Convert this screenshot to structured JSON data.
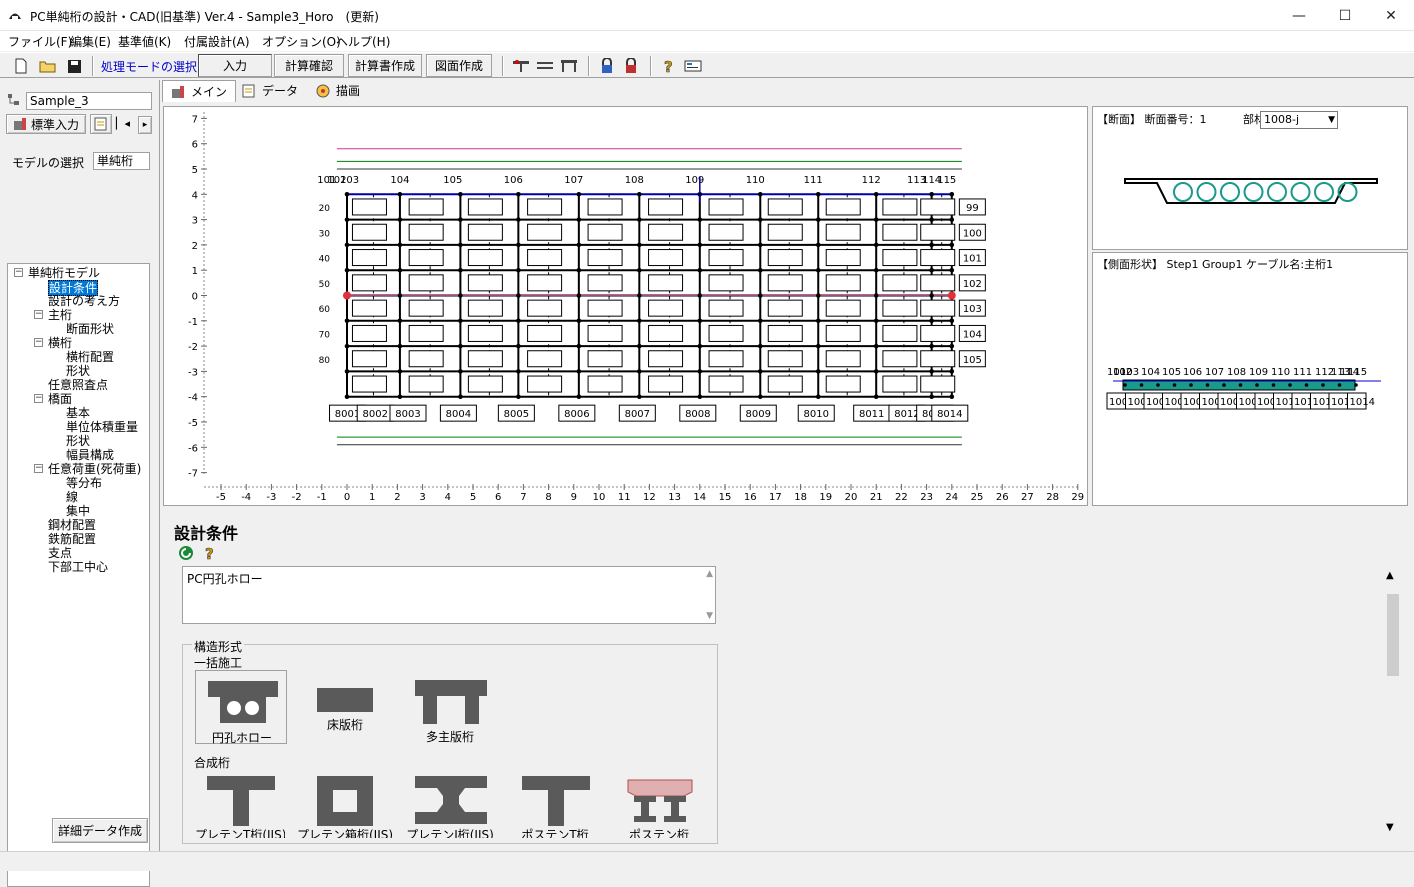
{
  "window": {
    "title": "PC単純桁の設計・CAD(旧基準) Ver.4 - Sample3_Horo　(更新)"
  },
  "menu": [
    "ファイル(F)",
    "編集(E)",
    "基準値(K)",
    "付属設計(A)",
    "オプション(O)",
    "ヘルプ(H)"
  ],
  "toolbar": {
    "mode_label": "処理モードの選択",
    "mode_value": "入力",
    "btn_check": "計算確認",
    "btn_report": "計算書作成",
    "btn_drawing": "図面作成"
  },
  "left": {
    "file_name": "Sample_3",
    "input_tab": "標準入力",
    "model_label": "モデルの選択",
    "model_value": "単純桁",
    "detail_button": "詳細データ作成",
    "tree": [
      {
        "label": "単純桁モデル",
        "level": 0,
        "toggle": "−"
      },
      {
        "label": "設計条件",
        "level": 1,
        "selected": true
      },
      {
        "label": "設計の考え方",
        "level": 1
      },
      {
        "label": "主桁",
        "level": 1,
        "toggle": "−"
      },
      {
        "label": "断面形状",
        "level": 2
      },
      {
        "label": "横桁",
        "level": 1,
        "toggle": "−"
      },
      {
        "label": "横桁配置",
        "level": 2
      },
      {
        "label": "形状",
        "level": 2
      },
      {
        "label": "任意照査点",
        "level": 1
      },
      {
        "label": "橋面",
        "level": 1,
        "toggle": "−"
      },
      {
        "label": "基本",
        "level": 2
      },
      {
        "label": "単位体積重量",
        "level": 2
      },
      {
        "label": "形状",
        "level": 2
      },
      {
        "label": "幅員構成",
        "level": 2
      },
      {
        "label": "任意荷重(死荷重)",
        "level": 1,
        "toggle": "−"
      },
      {
        "label": "等分布",
        "level": 2
      },
      {
        "label": "線",
        "level": 2
      },
      {
        "label": "集中",
        "level": 2
      },
      {
        "label": "鋼材配置",
        "level": 1
      },
      {
        "label": "鉄筋配置",
        "level": 1
      },
      {
        "label": "支点",
        "level": 1
      },
      {
        "label": "下部工中心",
        "level": 1
      }
    ]
  },
  "tabs": [
    "メイン",
    "データ",
    "描画"
  ],
  "plan": {
    "x_ticks": [
      "-5",
      "-4",
      "-3",
      "-2",
      "-1",
      "0",
      "1",
      "2",
      "3",
      "4",
      "5",
      "6",
      "7",
      "8",
      "9",
      "10",
      "11",
      "12",
      "13",
      "14",
      "15",
      "16",
      "17",
      "18",
      "19",
      "20",
      "21",
      "22",
      "23",
      "24",
      "25",
      "26",
      "27",
      "28",
      "29"
    ],
    "y_ticks": [
      "7",
      "6",
      "5",
      "4",
      "3",
      "2",
      "1",
      "0",
      "-1",
      "-2",
      "-3",
      "-4",
      "-5",
      "-6",
      "-7"
    ],
    "top_labels": [
      "101",
      "102",
      "103",
      "104",
      "105",
      "106",
      "107",
      "108",
      "109",
      "110",
      "111",
      "112",
      "113",
      "114",
      "115"
    ],
    "bottom_labels": [
      "8001",
      "8002",
      "8003",
      "8004",
      "8005",
      "8006",
      "8007",
      "8008",
      "8009",
      "8010",
      "8011",
      "8012",
      "8013",
      "8014"
    ],
    "right_labels": [
      "99",
      "100",
      "101",
      "102",
      "103",
      "104",
      "105"
    ],
    "left_labels": [
      "20",
      "30",
      "40",
      "50",
      "60",
      "70",
      "80"
    ]
  },
  "section": {
    "header": "【断面】 断面番号：1",
    "member_label": "部材:",
    "member_value": "1008-j"
  },
  "side": {
    "header": "【側面形状】 Step1 Group1 ケーブル名:主桁1",
    "top_labels": [
      "101",
      "102",
      "103",
      "104",
      "105",
      "106",
      "107",
      "108",
      "109",
      "110",
      "111",
      "112",
      "113",
      "114",
      "115"
    ],
    "bottom_labels": [
      "1001",
      "1002",
      "1003",
      "1004",
      "1005",
      "1006",
      "1007",
      "1008",
      "1009",
      "1010",
      "1011",
      "1012",
      "1013",
      "1014"
    ]
  },
  "lower": {
    "title": "設計条件",
    "memo": "PC円孔ホロー",
    "group_title": "構造形式",
    "group1": "一括施工",
    "group2": "合成桁",
    "types1": [
      "円孔ホロー",
      "床版桁",
      "多主版桁"
    ],
    "types2": [
      "プレテンT桁(JIS)",
      "プレテン箱桁(JIS)",
      "プレテンI桁(JIS)",
      "ポステンT桁",
      "ポステン桁"
    ]
  },
  "colors": {
    "accent": "#0078d7",
    "grid": "#000000",
    "section_fill": "#1a9a8a",
    "pink": "#cc3399",
    "green": "#008000",
    "red": "#e0303a"
  }
}
